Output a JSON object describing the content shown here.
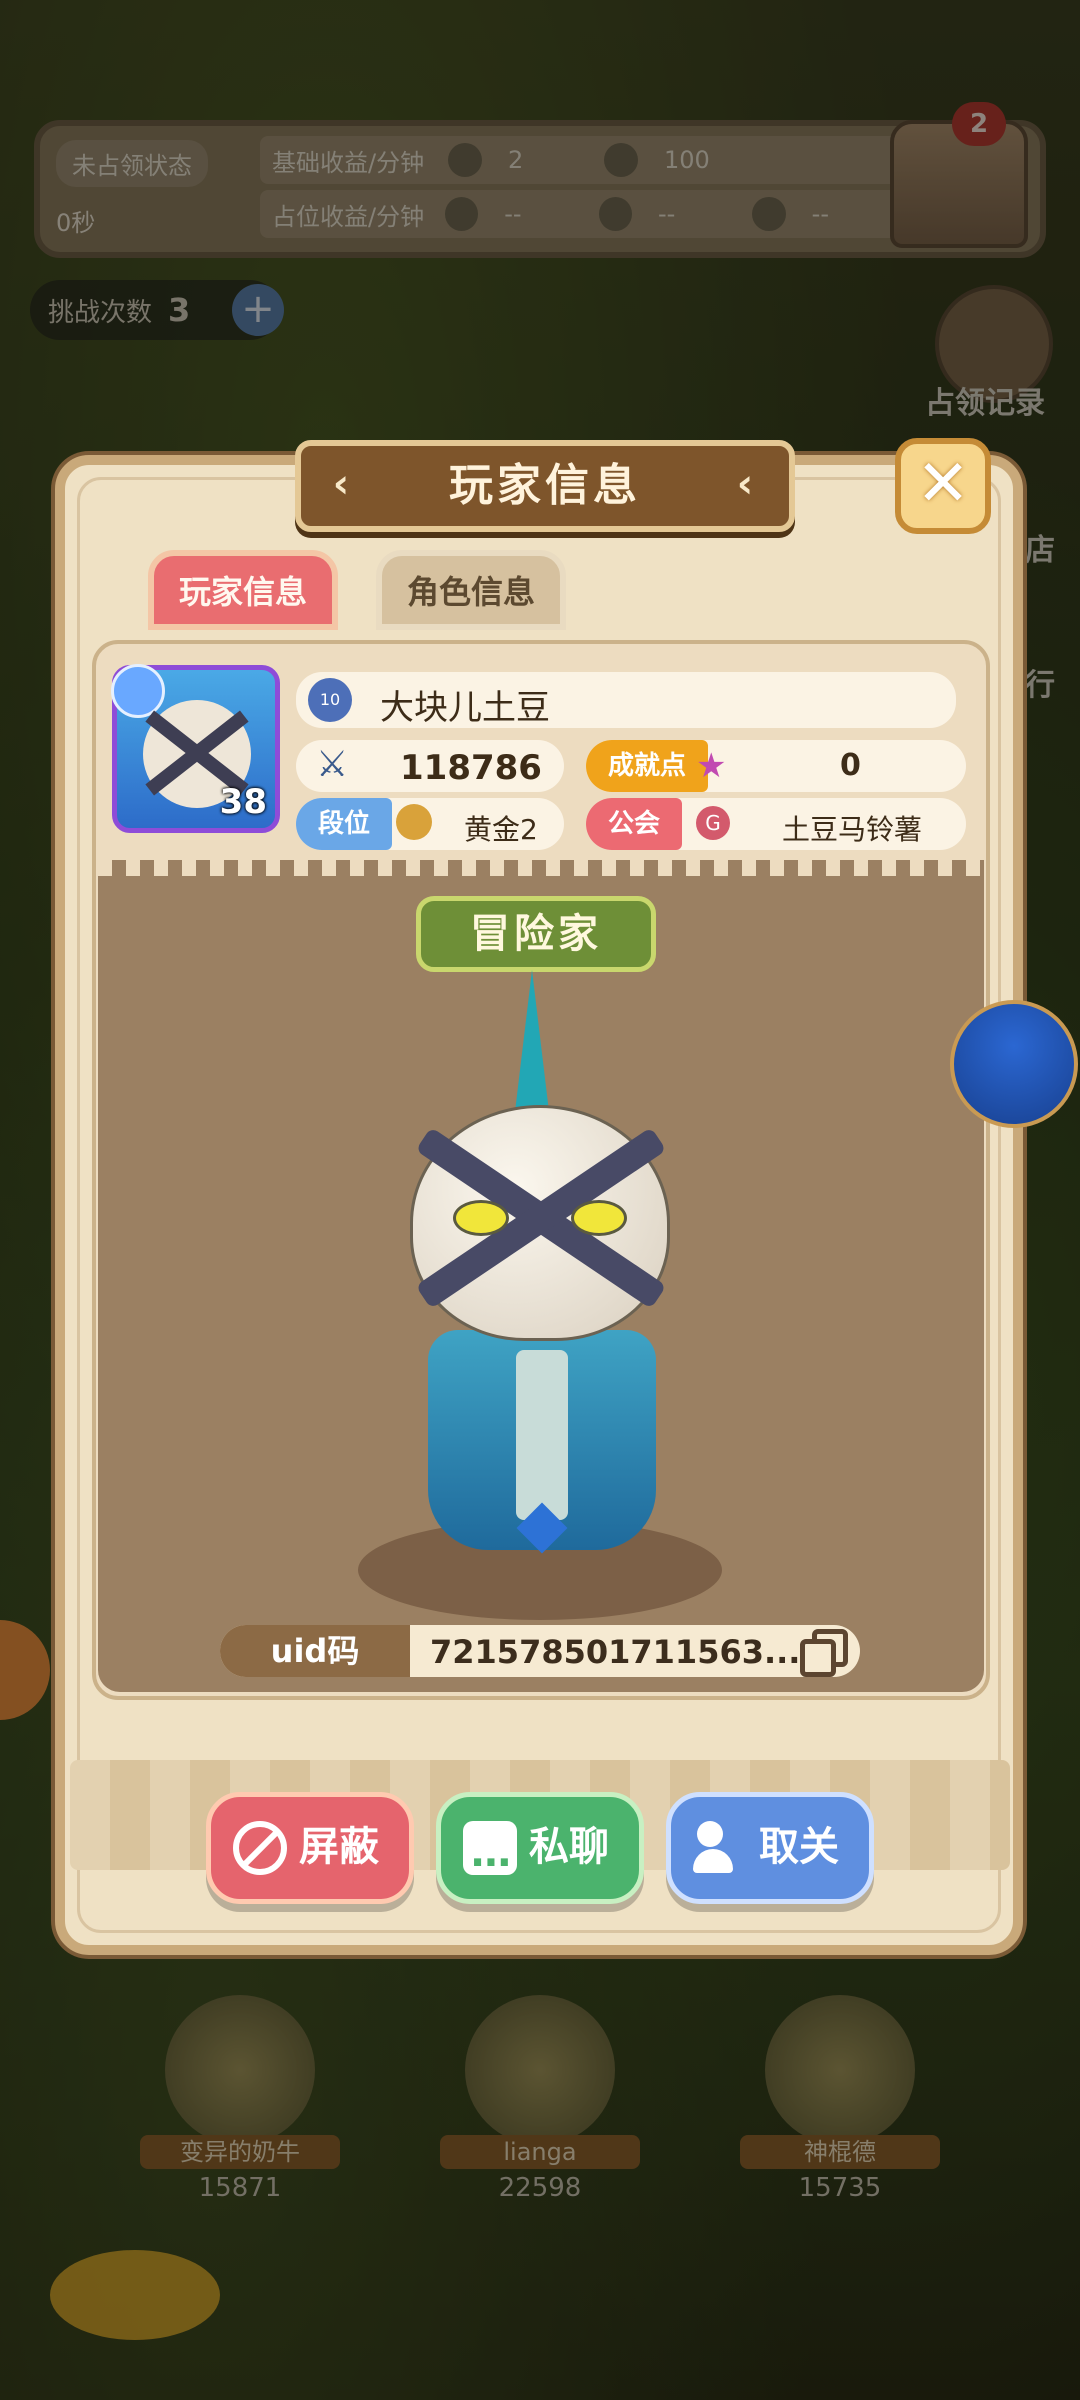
{
  "hud": {
    "status": "未占领状态",
    "time": "0秒",
    "rows": [
      {
        "label": "基础收益/分钟",
        "v1": "2",
        "v2": "100",
        "v3": ""
      },
      {
        "label": "占位收益/分钟",
        "v1": "--",
        "v2": "--",
        "v3": "--"
      }
    ],
    "chest_badge": "2"
  },
  "challenge": {
    "label": "挑战次数",
    "count": "3"
  },
  "side_buttons": {
    "record": "占领记录",
    "shop": "店",
    "rank": "行"
  },
  "modal": {
    "title": "玩家信息",
    "tabs": {
      "player": "玩家信息",
      "role": "角色信息"
    },
    "player": {
      "level_badge": "10",
      "name": "大块儿土豆",
      "avatar_level": "38",
      "power": "118786",
      "achievement_label": "成就点",
      "achievement_value": "0",
      "rank_label": "段位",
      "rank_value": "黄金2",
      "guild_label": "公会",
      "guild_value": "土豆马铃薯"
    },
    "hero_title": "冒险家",
    "uid_label": "uid码",
    "uid_value": "721578501711563..."
  },
  "actions": {
    "block": "屏蔽",
    "chat": "私聊",
    "unfollow": "取关"
  },
  "bottom_tiles": [
    {
      "name": "变异的奶牛",
      "power": "15871"
    },
    {
      "name": "lianga",
      "power": "22598"
    },
    {
      "name": "神棍德",
      "power": "15735"
    }
  ]
}
